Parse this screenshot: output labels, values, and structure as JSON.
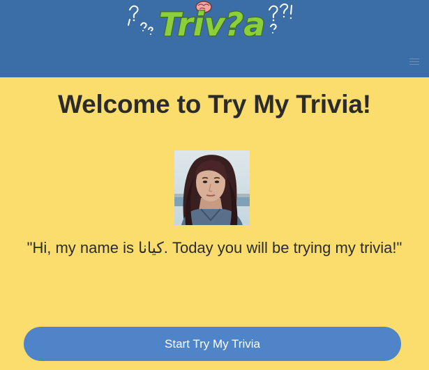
{
  "header": {
    "logo_text": "Triv?a",
    "logo_icon": "brain-icon",
    "menu_icon": "hamburger-menu-icon",
    "background_color": "#3b6ea6"
  },
  "main": {
    "title": "Welcome to Try My Trivia!",
    "avatar_icon": "profile-photo",
    "greeting": "\"Hi, my name is كيانا. Today you will be trying my trivia!\"",
    "start_button_label": "Start Try My Trivia",
    "background_color": "#fadd6c",
    "button_color": "#4f85c8"
  }
}
